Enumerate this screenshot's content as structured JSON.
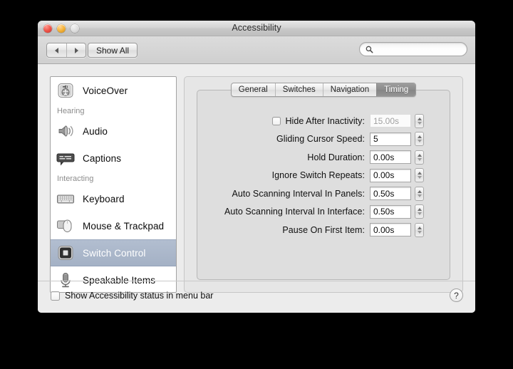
{
  "window": {
    "title": "Accessibility",
    "traffic_lights": [
      {
        "name": "close-button",
        "color": "#f0564b"
      },
      {
        "name": "minimize-button",
        "color": "#f5b43c"
      },
      {
        "name": "zoom-button",
        "color": "#dcdcdc"
      }
    ]
  },
  "toolbar": {
    "back_icon": "triangle-left-icon",
    "forward_icon": "triangle-right-icon",
    "show_all_label": "Show All",
    "search": {
      "icon": "search-icon",
      "value": "",
      "placeholder": ""
    }
  },
  "sidebar": {
    "items": [
      {
        "label": "VoiceOver",
        "icon": "voiceover-icon",
        "selected": false
      },
      {
        "header": "Hearing"
      },
      {
        "label": "Audio",
        "icon": "speaker-icon",
        "selected": false
      },
      {
        "label": "Captions",
        "icon": "captions-icon",
        "selected": false
      },
      {
        "header": "Interacting"
      },
      {
        "label": "Keyboard",
        "icon": "keyboard-icon",
        "selected": false
      },
      {
        "label": "Mouse & Trackpad",
        "icon": "mouse-trackpad-icon",
        "selected": false
      },
      {
        "label": "Switch Control",
        "icon": "switch-control-icon",
        "selected": true
      },
      {
        "label": "Speakable Items",
        "icon": "microphone-icon",
        "selected": false
      }
    ]
  },
  "pane": {
    "tabs": [
      {
        "label": "General",
        "active": false
      },
      {
        "label": "Switches",
        "active": false
      },
      {
        "label": "Navigation",
        "active": false
      },
      {
        "label": "Timing",
        "active": true
      }
    ],
    "rows": [
      {
        "label": "Hide After Inactivity:",
        "value": "15.00s",
        "checkbox": true,
        "checked": false,
        "disabled": true,
        "stepper": true
      },
      {
        "label": "Gliding Cursor Speed:",
        "value": "5",
        "checkbox": false,
        "disabled": false,
        "stepper": true
      },
      {
        "label": "Hold Duration:",
        "value": "0.00s",
        "checkbox": false,
        "disabled": false,
        "stepper": true
      },
      {
        "label": "Ignore Switch Repeats:",
        "value": "0.00s",
        "checkbox": false,
        "disabled": false,
        "stepper": true
      },
      {
        "label": "Auto Scanning Interval In Panels:",
        "value": "0.50s",
        "checkbox": false,
        "disabled": false,
        "stepper": true
      },
      {
        "label": "Auto Scanning Interval In Interface:",
        "value": "0.50s",
        "checkbox": false,
        "disabled": false,
        "stepper": true
      },
      {
        "label": "Pause On First Item:",
        "value": "0.00s",
        "checkbox": false,
        "disabled": false,
        "stepper": true
      }
    ]
  },
  "bottom": {
    "checkbox_label": "Show Accessibility status in menu bar",
    "checked": false,
    "help_label": "?"
  },
  "colors": {
    "selection": "#a4b1c5",
    "active_tab": "#8c8c8c",
    "window_bg": "#ececec",
    "desktop": "#000000"
  }
}
